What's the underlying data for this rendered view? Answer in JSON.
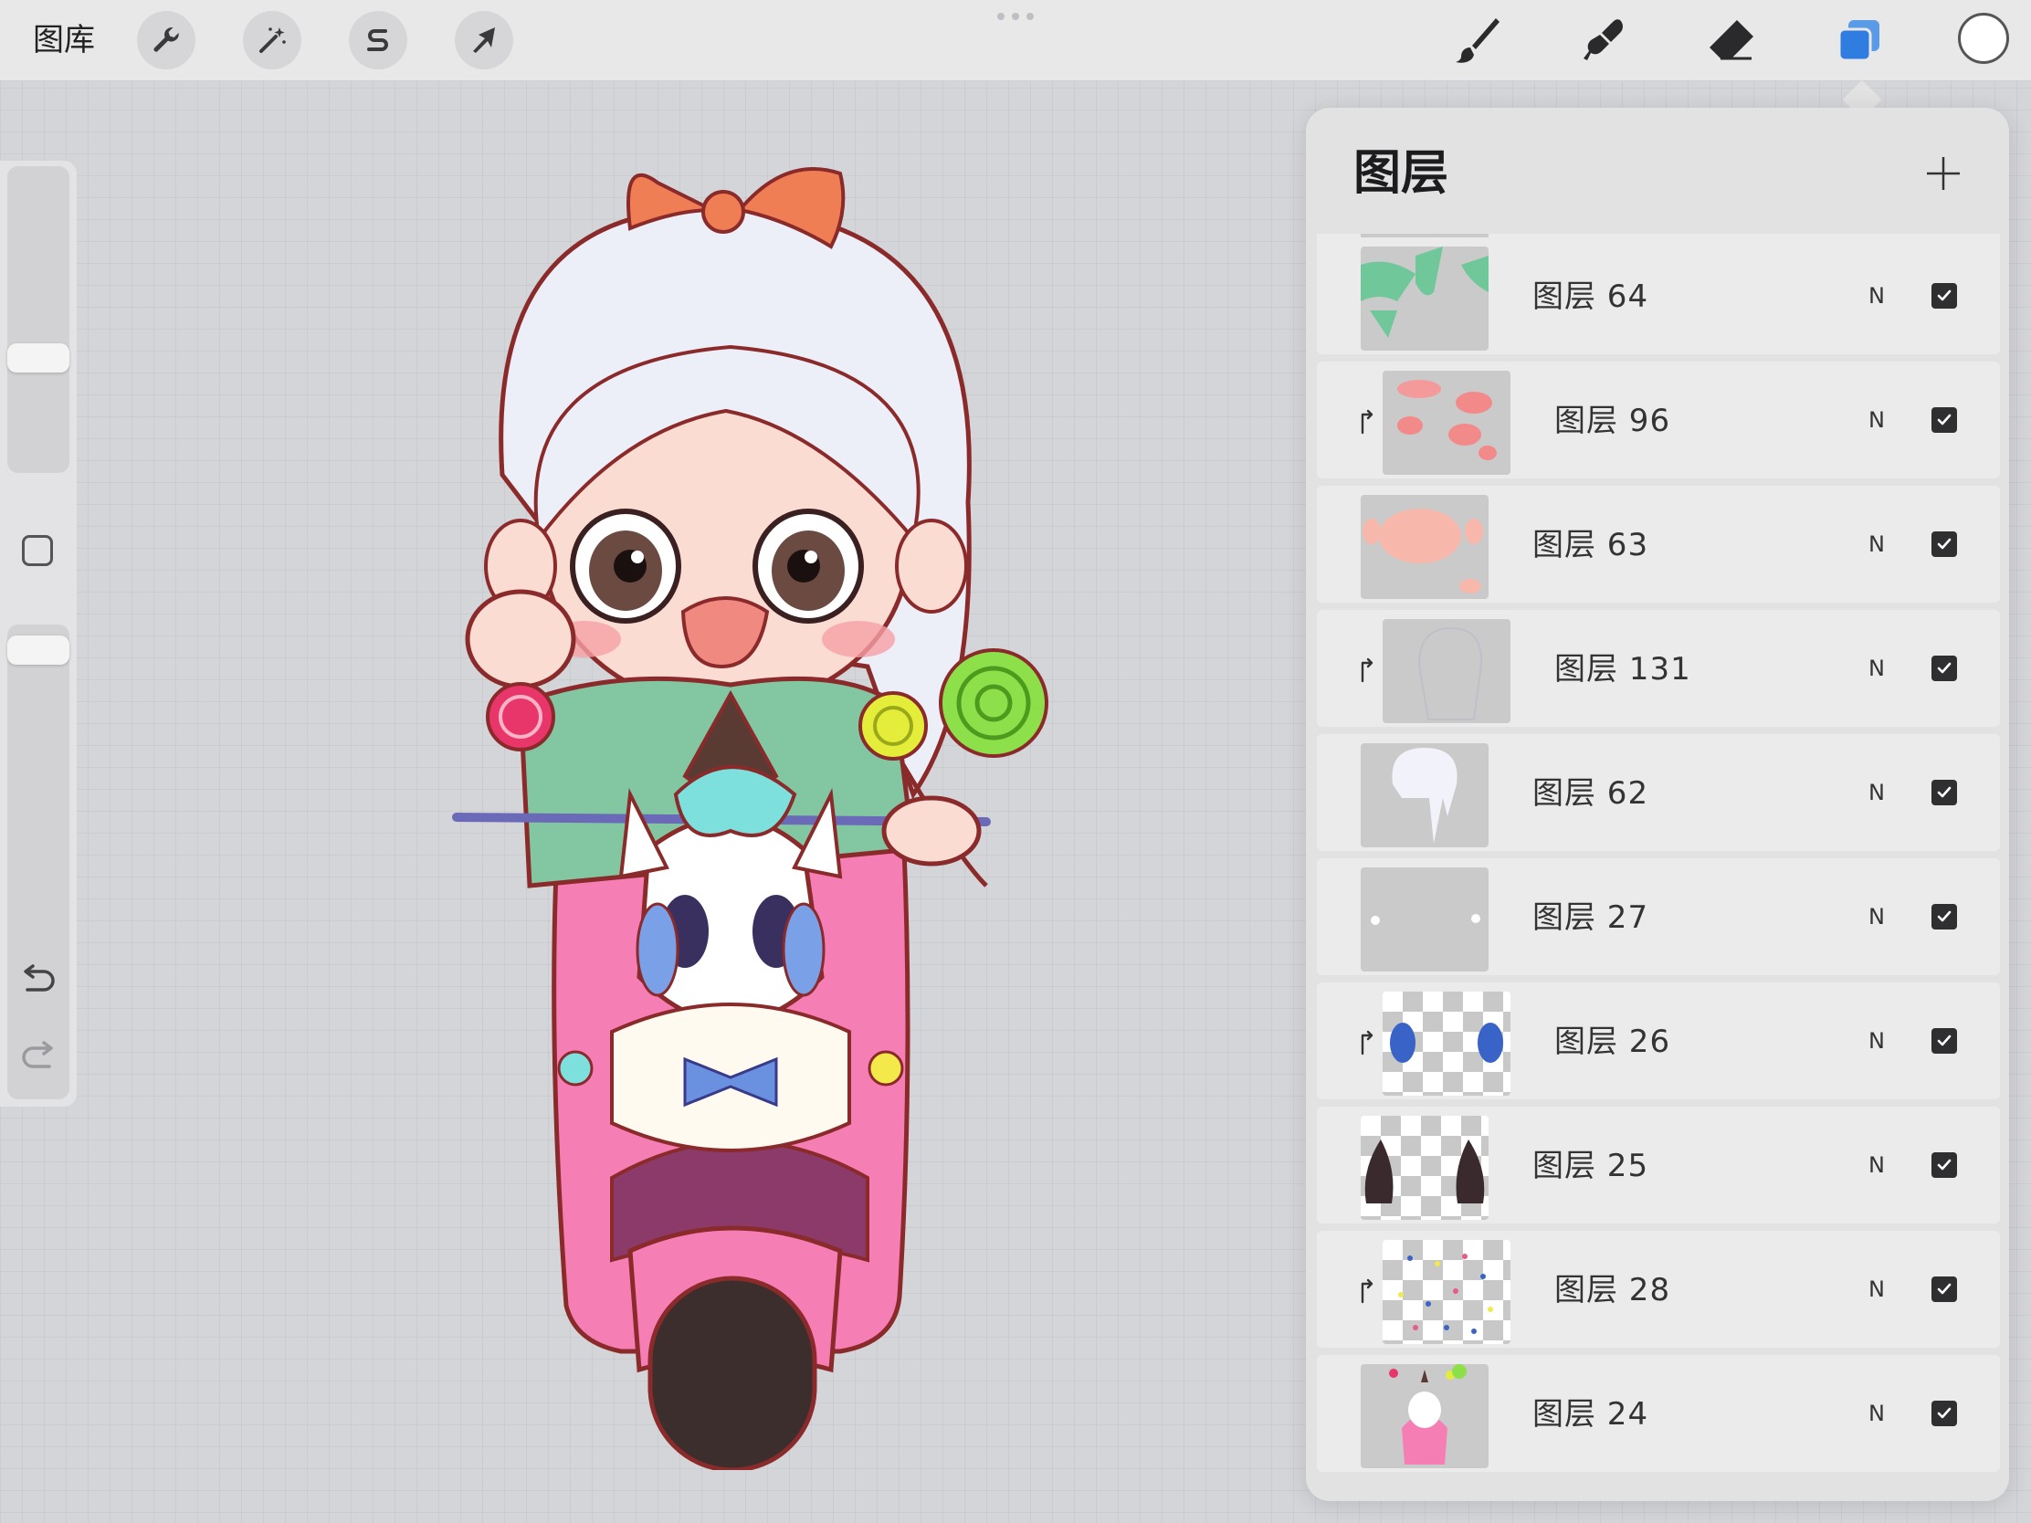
{
  "toolbar": {
    "gallery_label": "图库",
    "left_tools": [
      {
        "name": "actions",
        "icon": "wrench-icon"
      },
      {
        "name": "adjustments",
        "icon": "magic-wand-icon"
      },
      {
        "name": "selection",
        "icon": "selection-s-icon"
      },
      {
        "name": "transform",
        "icon": "arrow-cursor-icon"
      }
    ],
    "right_tools": [
      {
        "name": "brush",
        "icon": "brush-icon"
      },
      {
        "name": "smudge",
        "icon": "smudge-icon"
      },
      {
        "name": "eraser",
        "icon": "eraser-icon"
      },
      {
        "name": "layers",
        "icon": "layers-icon",
        "active": true
      }
    ],
    "current_color": "#ffffff",
    "accent_color": "#2f7de1"
  },
  "sidebar": {
    "brush_size_level": 0.58,
    "opacity_level": 0.96,
    "modify_icon": "square-icon",
    "undo_icon": "undo-icon",
    "redo_icon": "redo-icon"
  },
  "layers_panel": {
    "title": "图层",
    "add_icon": "plus-icon",
    "layers": [
      {
        "name": "图层 64",
        "blend": "N",
        "visible": true,
        "clipped": false
      },
      {
        "name": "图层 96",
        "blend": "N",
        "visible": true,
        "clipped": true
      },
      {
        "name": "图层 63",
        "blend": "N",
        "visible": true,
        "clipped": false
      },
      {
        "name": "图层 131",
        "blend": "N",
        "visible": true,
        "clipped": true
      },
      {
        "name": "图层 62",
        "blend": "N",
        "visible": true,
        "clipped": false
      },
      {
        "name": "图层 27",
        "blend": "N",
        "visible": true,
        "clipped": false
      },
      {
        "name": "图层 26",
        "blend": "N",
        "visible": true,
        "clipped": true
      },
      {
        "name": "图层 25",
        "blend": "N",
        "visible": true,
        "clipped": false
      },
      {
        "name": "图层 28",
        "blend": "N",
        "visible": true,
        "clipped": true
      },
      {
        "name": "图层 24",
        "blend": "N",
        "visible": true,
        "clipped": false
      }
    ]
  }
}
